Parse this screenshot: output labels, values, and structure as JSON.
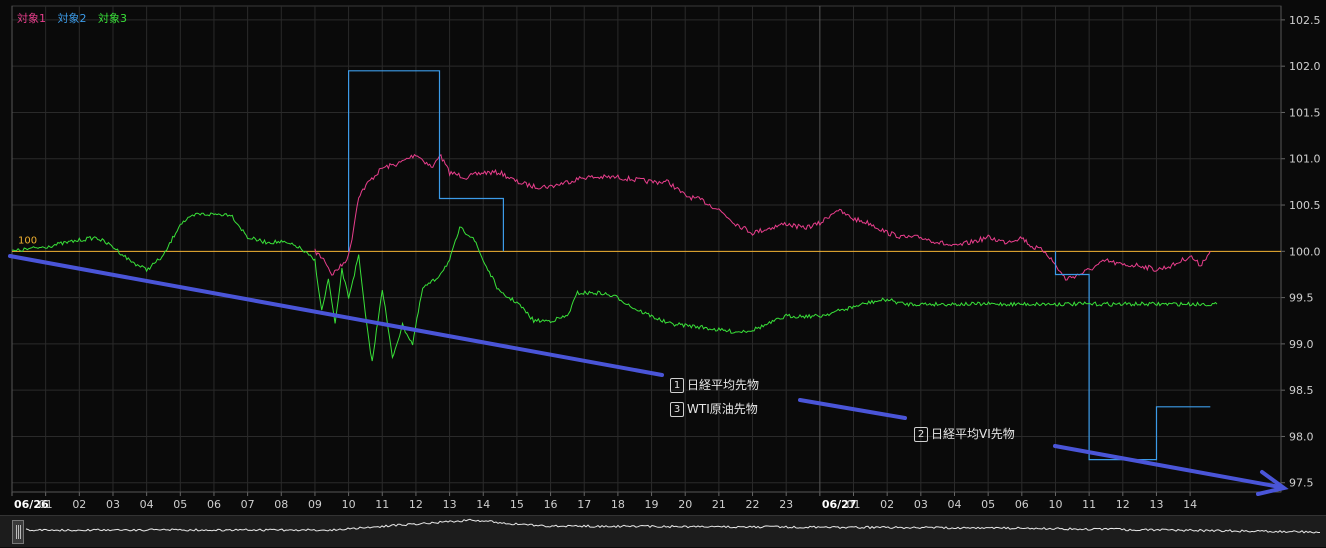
{
  "legend": [
    {
      "label": "対象1",
      "color": "#e83e8c"
    },
    {
      "label": "対象2",
      "color": "#3c9be8"
    },
    {
      "label": "対象3",
      "color": "#39e039"
    }
  ],
  "baseline_label": "100",
  "annotations": [
    {
      "num": "1",
      "text": "日経平均先物"
    },
    {
      "num": "3",
      "text": "WTI原油先物"
    },
    {
      "num": "2",
      "text": "日経平均VI先物"
    }
  ],
  "colors": {
    "baseline": "#f0b030",
    "arrow": "#4a55d8",
    "grid": "#2a2a2a",
    "axis_text": "#cfcfcf"
  },
  "chart_data": {
    "type": "line",
    "ylim": [
      97.4,
      102.65
    ],
    "y_ticks": [
      97.5,
      98.0,
      98.5,
      99.0,
      99.5,
      100.0,
      100.5,
      101.0,
      101.5,
      102.0,
      102.5
    ],
    "baseline": 100,
    "x_range": [
      0,
      37.7
    ],
    "x_ticks": [
      {
        "x": 0,
        "label": "06/26",
        "bold": true
      },
      {
        "x": 1,
        "label": "01"
      },
      {
        "x": 2,
        "label": "02"
      },
      {
        "x": 3,
        "label": "03"
      },
      {
        "x": 4,
        "label": "04"
      },
      {
        "x": 5,
        "label": "05"
      },
      {
        "x": 6,
        "label": "06"
      },
      {
        "x": 7,
        "label": "07"
      },
      {
        "x": 8,
        "label": "08"
      },
      {
        "x": 9,
        "label": "09"
      },
      {
        "x": 10,
        "label": "10"
      },
      {
        "x": 11,
        "label": "11"
      },
      {
        "x": 12,
        "label": "12"
      },
      {
        "x": 13,
        "label": "13"
      },
      {
        "x": 14,
        "label": "14"
      },
      {
        "x": 15,
        "label": "15"
      },
      {
        "x": 16,
        "label": "16"
      },
      {
        "x": 17,
        "label": "17"
      },
      {
        "x": 18,
        "label": "18"
      },
      {
        "x": 19,
        "label": "19"
      },
      {
        "x": 20,
        "label": "20"
      },
      {
        "x": 21,
        "label": "21"
      },
      {
        "x": 22,
        "label": "22"
      },
      {
        "x": 23,
        "label": "23"
      },
      {
        "x": 24,
        "label": "06/27",
        "bold": true
      },
      {
        "x": 25,
        "label": "01"
      },
      {
        "x": 26,
        "label": "02"
      },
      {
        "x": 27,
        "label": "03"
      },
      {
        "x": 28,
        "label": "04"
      },
      {
        "x": 29,
        "label": "05"
      },
      {
        "x": 30,
        "label": "06"
      },
      {
        "x": 31,
        "label": "10"
      },
      {
        "x": 32,
        "label": "11"
      },
      {
        "x": 33,
        "label": "12"
      },
      {
        "x": 34,
        "label": "13"
      },
      {
        "x": 35,
        "label": "14"
      }
    ],
    "series": [
      {
        "name": "対象1",
        "color": "#e83e8c",
        "step": false,
        "points": [
          [
            9.0,
            100.0
          ],
          [
            9.3,
            99.9
          ],
          [
            9.5,
            99.75
          ],
          [
            9.8,
            99.85
          ],
          [
            10.0,
            99.95
          ],
          [
            10.1,
            100.15
          ],
          [
            10.3,
            100.6
          ],
          [
            10.6,
            100.75
          ],
          [
            11.0,
            100.9
          ],
          [
            11.5,
            100.95
          ],
          [
            12.0,
            101.05
          ],
          [
            12.5,
            100.9
          ],
          [
            12.7,
            101.05
          ],
          [
            13.0,
            100.85
          ],
          [
            13.5,
            100.8
          ],
          [
            14.0,
            100.85
          ],
          [
            14.5,
            100.85
          ],
          [
            15.0,
            100.75
          ],
          [
            15.5,
            100.7
          ],
          [
            16.0,
            100.7
          ],
          [
            16.5,
            100.75
          ],
          [
            17.0,
            100.8
          ],
          [
            18.0,
            100.8
          ],
          [
            19.0,
            100.75
          ],
          [
            19.5,
            100.75
          ],
          [
            20.0,
            100.6
          ],
          [
            20.5,
            100.55
          ],
          [
            21.0,
            100.45
          ],
          [
            21.5,
            100.3
          ],
          [
            22.0,
            100.2
          ],
          [
            22.5,
            100.25
          ],
          [
            23.0,
            100.3
          ],
          [
            23.5,
            100.25
          ],
          [
            24.0,
            100.3
          ],
          [
            24.5,
            100.45
          ],
          [
            25.0,
            100.35
          ],
          [
            25.5,
            100.3
          ],
          [
            26.0,
            100.2
          ],
          [
            26.5,
            100.15
          ],
          [
            27.0,
            100.15
          ],
          [
            27.5,
            100.1
          ],
          [
            28.0,
            100.05
          ],
          [
            28.5,
            100.1
          ],
          [
            29.0,
            100.15
          ],
          [
            29.5,
            100.1
          ],
          [
            30.0,
            100.15
          ],
          [
            30.3,
            100.05
          ],
          [
            30.7,
            100.0
          ],
          [
            31.0,
            99.85
          ],
          [
            31.3,
            99.7
          ],
          [
            31.7,
            99.75
          ],
          [
            32.0,
            99.8
          ],
          [
            32.5,
            99.9
          ],
          [
            33.0,
            99.85
          ],
          [
            33.5,
            99.85
          ],
          [
            34.0,
            99.8
          ],
          [
            34.5,
            99.85
          ],
          [
            35.0,
            99.95
          ],
          [
            35.3,
            99.85
          ],
          [
            35.6,
            100.0
          ]
        ]
      },
      {
        "name": "対象2",
        "color": "#3c9be8",
        "step": true,
        "segments": [
          [
            [
              10.0,
              100.0
            ],
            [
              10.0,
              101.95
            ],
            [
              12.7,
              101.95
            ],
            [
              12.7,
              100.57
            ],
            [
              14.6,
              100.57
            ],
            [
              14.6,
              100.3
            ],
            [
              14.6,
              100.0
            ]
          ],
          [
            [
              31.0,
              100.0
            ],
            [
              31.0,
              99.75
            ],
            [
              32.0,
              99.75
            ],
            [
              32.0,
              97.75
            ],
            [
              34.0,
              97.75
            ],
            [
              34.0,
              98.32
            ],
            [
              35.6,
              98.32
            ]
          ]
        ]
      },
      {
        "name": "対象3",
        "color": "#39e039",
        "step": false,
        "points": [
          [
            0,
            100.0
          ],
          [
            1.0,
            100.05
          ],
          [
            2.0,
            100.12
          ],
          [
            2.5,
            100.15
          ],
          [
            3.0,
            100.05
          ],
          [
            3.5,
            99.9
          ],
          [
            4.0,
            99.8
          ],
          [
            4.5,
            99.95
          ],
          [
            5.0,
            100.3
          ],
          [
            5.5,
            100.4
          ],
          [
            6.0,
            100.4
          ],
          [
            6.5,
            100.4
          ],
          [
            7.0,
            100.15
          ],
          [
            7.5,
            100.1
          ],
          [
            8.0,
            100.1
          ],
          [
            8.5,
            100.05
          ],
          [
            9.0,
            99.9
          ],
          [
            9.2,
            99.35
          ],
          [
            9.4,
            99.7
          ],
          [
            9.6,
            99.2
          ],
          [
            9.8,
            99.8
          ],
          [
            10.0,
            99.5
          ],
          [
            10.3,
            99.95
          ],
          [
            10.5,
            99.3
          ],
          [
            10.7,
            98.8
          ],
          [
            11.0,
            99.6
          ],
          [
            11.3,
            98.85
          ],
          [
            11.6,
            99.2
          ],
          [
            11.9,
            99.0
          ],
          [
            12.2,
            99.6
          ],
          [
            12.6,
            99.7
          ],
          [
            13.0,
            99.9
          ],
          [
            13.3,
            100.25
          ],
          [
            13.7,
            100.15
          ],
          [
            14.0,
            99.9
          ],
          [
            14.5,
            99.55
          ],
          [
            15.0,
            99.45
          ],
          [
            15.5,
            99.25
          ],
          [
            16.0,
            99.25
          ],
          [
            16.5,
            99.3
          ],
          [
            16.8,
            99.55
          ],
          [
            17.5,
            99.55
          ],
          [
            18.0,
            99.5
          ],
          [
            18.5,
            99.38
          ],
          [
            19.0,
            99.3
          ],
          [
            19.5,
            99.22
          ],
          [
            20.0,
            99.2
          ],
          [
            20.5,
            99.18
          ],
          [
            21.0,
            99.15
          ],
          [
            21.5,
            99.13
          ],
          [
            22.0,
            99.15
          ],
          [
            22.5,
            99.22
          ],
          [
            23.0,
            99.3
          ],
          [
            23.5,
            99.3
          ],
          [
            24.0,
            99.3
          ],
          [
            24.5,
            99.35
          ],
          [
            25.0,
            99.4
          ],
          [
            25.5,
            99.45
          ],
          [
            26.0,
            99.48
          ],
          [
            26.5,
            99.43
          ],
          [
            27.0,
            99.43
          ],
          [
            35.8,
            99.43
          ]
        ]
      }
    ]
  }
}
